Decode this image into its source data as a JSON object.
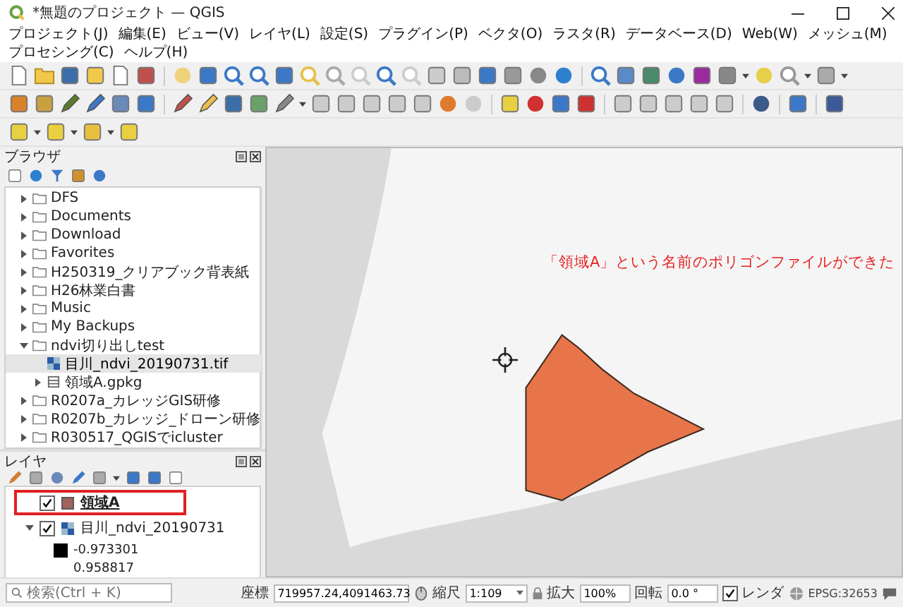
{
  "window": {
    "title": "*無題のプロジェクト — QGIS"
  },
  "menu": [
    "プロジェクト(J)",
    "編集(E)",
    "ビュー(V)",
    "レイヤ(L)",
    "設定(S)",
    "プラグイン(P)",
    "ベクタ(O)",
    "ラスタ(R)",
    "データベース(D)",
    "Web(W)",
    "メッシュ(M)",
    "プロセシング(C)",
    "ヘルプ(H)"
  ],
  "browser": {
    "title": "ブラウザ",
    "items": [
      {
        "label": "DFS",
        "kind": "folder",
        "expanded": false,
        "selected": false
      },
      {
        "label": "Documents",
        "kind": "folder",
        "expanded": false,
        "selected": false
      },
      {
        "label": "Download",
        "kind": "folder",
        "expanded": false,
        "selected": false
      },
      {
        "label": "Favorites",
        "kind": "folder",
        "expanded": false,
        "selected": false
      },
      {
        "label": "H250319_クリアブック背表紙",
        "kind": "folder",
        "expanded": false,
        "selected": false
      },
      {
        "label": "H26林業白書",
        "kind": "folder",
        "expanded": false,
        "selected": false
      },
      {
        "label": "Music",
        "kind": "folder",
        "expanded": false,
        "selected": false
      },
      {
        "label": "My Backups",
        "kind": "folder",
        "expanded": false,
        "selected": false
      },
      {
        "label": "ndvi切り出しtest",
        "kind": "folder",
        "expanded": true,
        "selected": false,
        "children": [
          {
            "label": "目川_ndvi_20190731.tif",
            "kind": "raster",
            "selected": true
          },
          {
            "label": "領域A.gpkg",
            "kind": "geopackage",
            "expanded": false,
            "selected": false
          }
        ]
      },
      {
        "label": "R0207a_カレッジGIS研修",
        "kind": "folder",
        "expanded": false,
        "selected": false
      },
      {
        "label": "R0207b_カレッジ_ドローン研修",
        "kind": "folder",
        "expanded": false,
        "selected": false
      },
      {
        "label": "R030517_QGISでicluster",
        "kind": "folder",
        "expanded": false,
        "selected": false
      }
    ]
  },
  "layers": {
    "title": "レイヤ",
    "items": [
      {
        "name": "領域A",
        "kind": "vector",
        "checked": true,
        "selected": true,
        "highlighted": true
      },
      {
        "name": "目川_ndvi_20190731",
        "kind": "raster",
        "checked": true,
        "selected": false,
        "highlighted": false,
        "expanded": true,
        "legend": [
          "-0.973301",
          "0.958817"
        ]
      }
    ]
  },
  "map": {
    "annotation": "「領域A」という名前のポリゴンファイルができた"
  },
  "status_bar": {
    "search": {
      "placeholder": "検索(Ctrl + K)"
    },
    "coordinate_label": "座標",
    "coordinate": "719957.24,4091463.73",
    "scale_label": "縮尺",
    "scale": "1:109",
    "magnifier_label": "拡大",
    "magnifier": "100%",
    "rotation_label": "回転",
    "rotation": "0.0 °",
    "render": {
      "label": "レンダ",
      "checked": true
    },
    "crs": "EPSG:32653"
  }
}
